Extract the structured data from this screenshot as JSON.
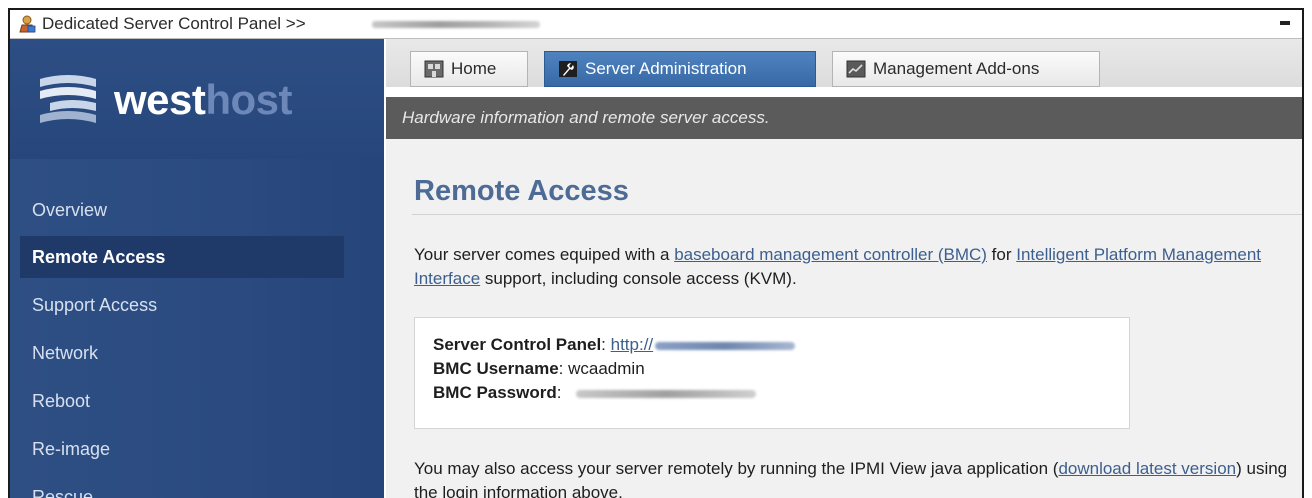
{
  "window": {
    "title": "Dedicated Server Control Panel >>"
  },
  "sidebar": {
    "logo": {
      "bright": "west",
      "dim": "host"
    },
    "items": [
      {
        "label": "Overview",
        "active": false
      },
      {
        "label": "Remote Access",
        "active": true
      },
      {
        "label": "Support Access",
        "active": false
      },
      {
        "label": "Network",
        "active": false
      },
      {
        "label": "Reboot",
        "active": false
      },
      {
        "label": "Re-image",
        "active": false
      },
      {
        "label": "Rescue",
        "active": false
      }
    ]
  },
  "tabs": [
    {
      "label": "Home",
      "icon": "home-icon",
      "active": false
    },
    {
      "label": "Server Administration",
      "icon": "wrench-icon",
      "active": true
    },
    {
      "label": "Management Add-ons",
      "icon": "chart-icon",
      "active": false
    }
  ],
  "subheader": "Hardware information and remote server access.",
  "content": {
    "title": "Remote Access",
    "intro": {
      "t1": "Your server comes equiped with a ",
      "link1": "baseboard management controller (BMC)",
      "t2": " for ",
      "link2": "Intelligent Platform Management Interface",
      "t3": " support, including console access (KVM)."
    },
    "info": {
      "cp_label": "Server Control Panel",
      "cp_value": "http://",
      "user_label": "BMC Username",
      "user_value": "wcaadmin",
      "pass_label": "BMC Password"
    },
    "outro": {
      "t1": "You may also access your server remotely by running the IPMI View java application (",
      "link": "download latest version",
      "t2": ") using the login information above."
    }
  },
  "colors": {
    "sidebar": "#2a4a80",
    "sidebar_active": "#1f3a68",
    "tab_active": "#3d6faa",
    "subheader": "#5b5b5b",
    "title": "#4d6b95",
    "link": "#3c5f8f"
  }
}
